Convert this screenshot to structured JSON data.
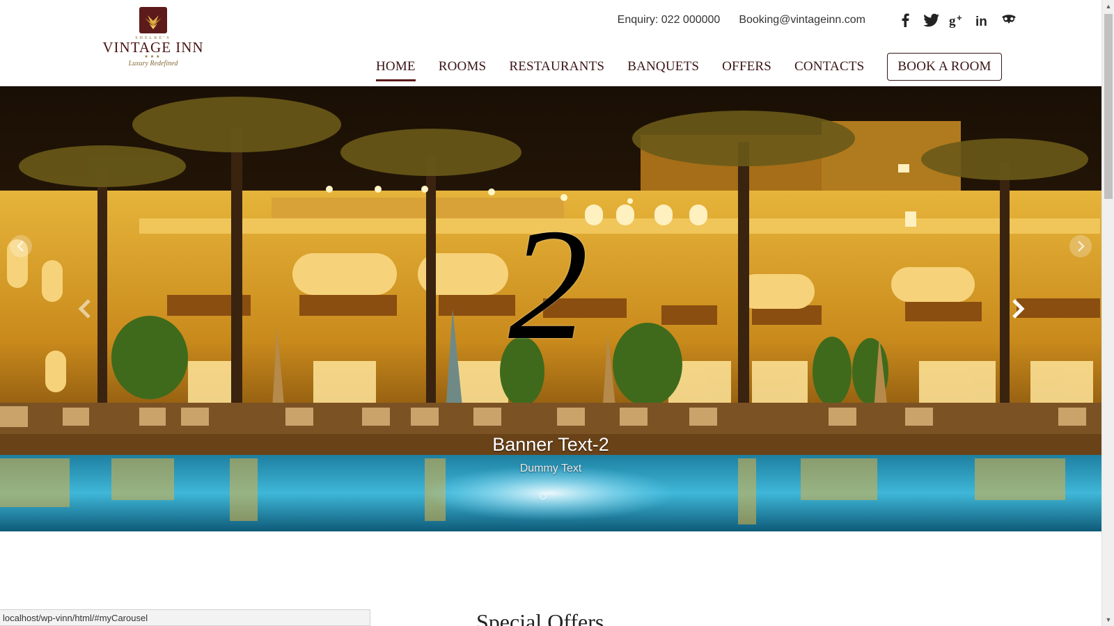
{
  "brand": {
    "pre_name": "SHELKE'S",
    "name": "VINTAGE INN",
    "stars": "★★★",
    "tagline": "Luxury Redefined"
  },
  "contact": {
    "enquiry": "Enquiry: 022 000000",
    "email": "Booking@vintageinn.com"
  },
  "social_icons": [
    "facebook-icon",
    "twitter-icon",
    "google-plus-icon",
    "linkedin-icon",
    "tripadvisor-icon"
  ],
  "nav": {
    "items": [
      {
        "label": "HOME",
        "active": true
      },
      {
        "label": "ROOMS",
        "active": false
      },
      {
        "label": "RESTAURANTS",
        "active": false
      },
      {
        "label": "BANQUETS",
        "active": false
      },
      {
        "label": "OFFERS",
        "active": false
      },
      {
        "label": "CONTACTS",
        "active": false
      }
    ],
    "book_label": "BOOK A ROOM"
  },
  "carousel": {
    "slide_number": "2",
    "caption_title": "Banner Text-2",
    "caption_sub": "Dummy Text"
  },
  "section": {
    "title": "Special Offers"
  },
  "status_bar": {
    "url": "localhost/wp-vinn/html/#myCarousel"
  },
  "colors": {
    "brand": "#5c1a1a",
    "nav_text": "#3a1414",
    "gold": "#8a6a3a"
  }
}
